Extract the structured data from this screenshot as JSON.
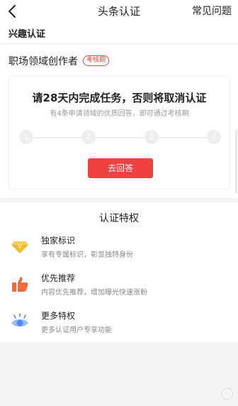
{
  "nav": {
    "title": "头条认证",
    "faq_label": "常见问题",
    "back_icon": "chevron-left-icon"
  },
  "interest": {
    "label": "兴趣认证"
  },
  "domain": {
    "label": "职场领域创作者",
    "badge": "考核期"
  },
  "task_card": {
    "heading": "请28天内完成任务，否则将取消认证",
    "subtitle": "有4条申请领域的优质回答，即可通过考核期",
    "steps": [
      "1",
      "2",
      "3",
      "4"
    ],
    "button_label": "去回答"
  },
  "privileges": {
    "title": "认证特权",
    "items": [
      {
        "icon": "diamond-icon",
        "name": "独家标识",
        "desc": "享有专属标识，彰显独特身份"
      },
      {
        "icon": "thumbs-up-icon",
        "name": "优先推荐",
        "desc": "内容优先推荐，增加曝光快速涨粉"
      },
      {
        "icon": "eye-icon",
        "name": "更多特权",
        "desc": "更多认证用户专享功能"
      }
    ]
  },
  "colors": {
    "accent": "#f04142",
    "step_inactive": "#eeeeee",
    "diamond": "#f5b82e",
    "thumb": "#f36b3c",
    "eye": "#4e8cf0"
  }
}
